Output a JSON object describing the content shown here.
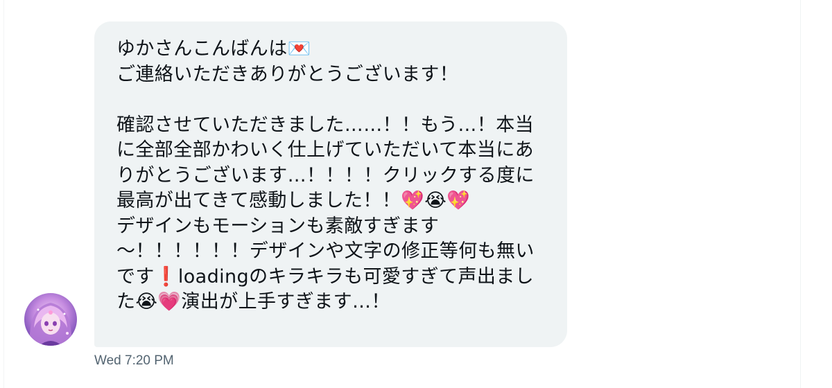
{
  "message": {
    "text": "ゆかさんこんばんは💌\nご連絡いただきありがとうございます！\n\n確認させていただきました……！！もう…！本当に全部全部かわいく仕上げていただいて本当にありがとうございます…！！！！クリックする度に最高が出てきて感動しました！！💖😭💖\nデザインもモーションも素敵すぎます\n〜！！！！！！デザインや文字の修正等何も無いです❗️loadingのキラキラも可愛すぎて声出ました😭💗演出が上手すぎます…！",
    "timestamp": "Wed 7:20 PM"
  },
  "sender": {
    "avatar_icon": "anime-girl-avatar",
    "avatar_colors": [
      "#f3d4f6",
      "#c58be0",
      "#7c4fb8",
      "#4a2d7a"
    ]
  },
  "colors": {
    "bubble_background": "#eff3f4",
    "text": "#0f1419",
    "timestamp": "#536471"
  }
}
